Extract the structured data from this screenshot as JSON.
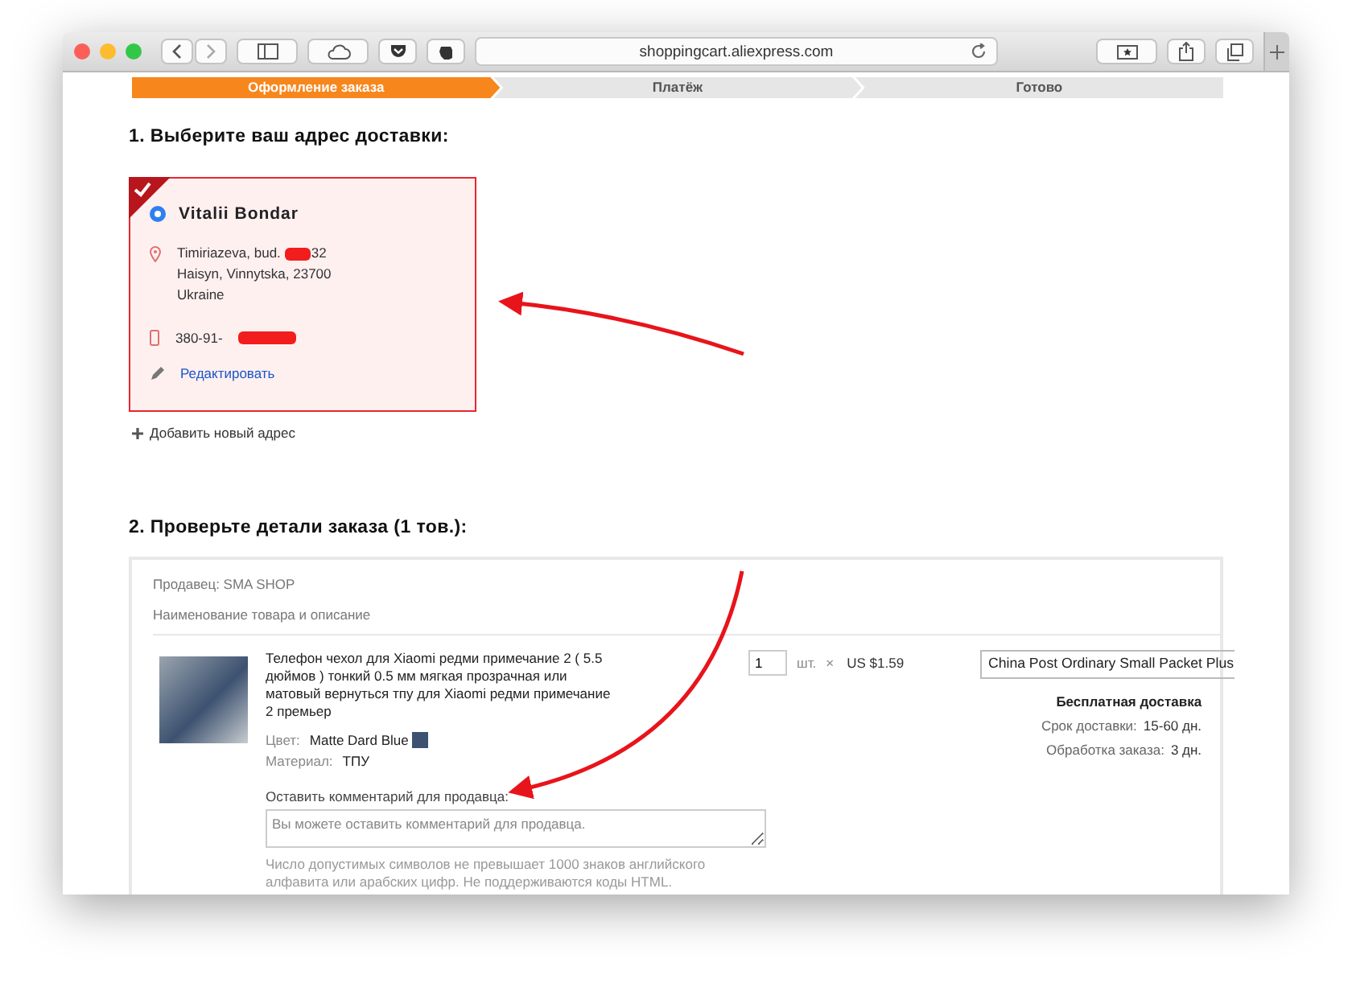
{
  "browser": {
    "url": "shoppingcart.aliexpress.com"
  },
  "steps": [
    {
      "label": "Оформление заказа",
      "selected": true
    },
    {
      "label": "Платёж",
      "selected": false
    },
    {
      "label": "Готово",
      "selected": false
    }
  ],
  "address_section": {
    "heading": "1. Выберите ваш адрес доставки:",
    "card": {
      "selected": true,
      "name": "Vitalii Bondar",
      "address_line_1": "Timiriazeva, bud.",
      "address_line_1_end": "32",
      "address_lines": [
        "Haisyn, Vinnytska, 23700",
        "Ukraine"
      ],
      "phone": "380-91-",
      "edit_link": "Редактировать"
    },
    "add_link": "Добавить новый адрес"
  },
  "order_section": {
    "heading": "2. Проверьте детали заказа (1 тов.):",
    "seller": "Продавец: SMA SHOP",
    "column_header": "Наименование товара и описание",
    "item": {
      "title": "Телефон чехол для Xiaomi редми примечание 2 ( 5.5 дюймов ) тонкий 0.5 мм мягкая прозрачная или матовый вернуться тпу для Xiaomi редми примечание 2 премьер",
      "color_label": "Цвет:",
      "color_value": "Matte Dard Blue",
      "material_label": "Материал:",
      "material_value": "ТПУ",
      "quantity": "1",
      "unit": "шт.",
      "times": "×",
      "price": "US $1.59",
      "shipping_method": "China Post Ordinary Small Packet Plus",
      "free_shipping": "Бесплатная доставка",
      "delivery_label": "Срок доставки:",
      "delivery_value": "15-60 дн.",
      "processing_label": "Обработка заказа:",
      "processing_value": "3 дн."
    },
    "comment_label": "Оставить комментарий для продавца:",
    "comment_placeholder": "Вы можете оставить комментарий для продавца.",
    "comment_hint": "Число допустимых символов не превышает 1000 знаков английского алфавита или арабских цифр. Не поддерживаются коды HTML."
  }
}
